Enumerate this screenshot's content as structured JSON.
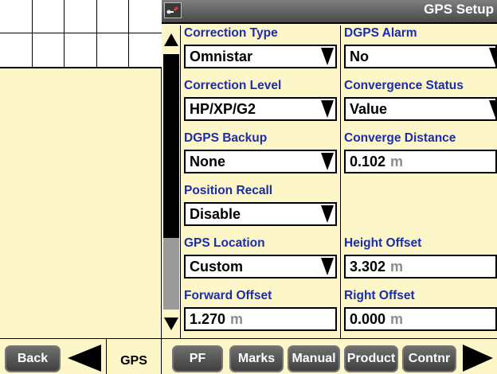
{
  "header": {
    "title": "GPS Setup",
    "icon": "wrench-tool-icon"
  },
  "colors": {
    "background": "#fdf6c8",
    "label": "#1a2daa",
    "unit": "#8c8c8c",
    "button": "#505050"
  },
  "scrollbar": {
    "position_fraction": 0.0,
    "visible_fraction": 0.72
  },
  "fields": [
    {
      "label": "Correction Type",
      "value": "Omnistar",
      "unit": "",
      "dropdown": true
    },
    {
      "label": "DGPS Alarm",
      "value": "No",
      "unit": "",
      "dropdown": true
    },
    {
      "label": "Correction Level",
      "value": "HP/XP/G2",
      "unit": "",
      "dropdown": true
    },
    {
      "label": "Convergence Status",
      "value": "Value",
      "unit": "",
      "dropdown": true
    },
    {
      "label": "DGPS Backup",
      "value": "None",
      "unit": "",
      "dropdown": true
    },
    {
      "label": "Converge Distance",
      "value": "0.102",
      "unit": "m",
      "dropdown": false
    },
    {
      "label": "Position Recall",
      "value": "Disable",
      "unit": "",
      "dropdown": true
    },
    {
      "label": "Height Offset",
      "value": "3.302",
      "unit": "m",
      "dropdown": false
    },
    {
      "label": "GPS Location",
      "value": "Custom",
      "unit": "",
      "dropdown": true
    },
    {
      "label": "Forward Offset",
      "value": "1.270",
      "unit": "m",
      "dropdown": false
    },
    {
      "label": "Right Offset",
      "value": "0.000",
      "unit": "m",
      "dropdown": false
    }
  ],
  "nav": {
    "back": "Back",
    "active_tab": "GPS",
    "buttons": [
      "PF",
      "Marks",
      "Manual",
      "Product",
      "Contnr"
    ]
  }
}
